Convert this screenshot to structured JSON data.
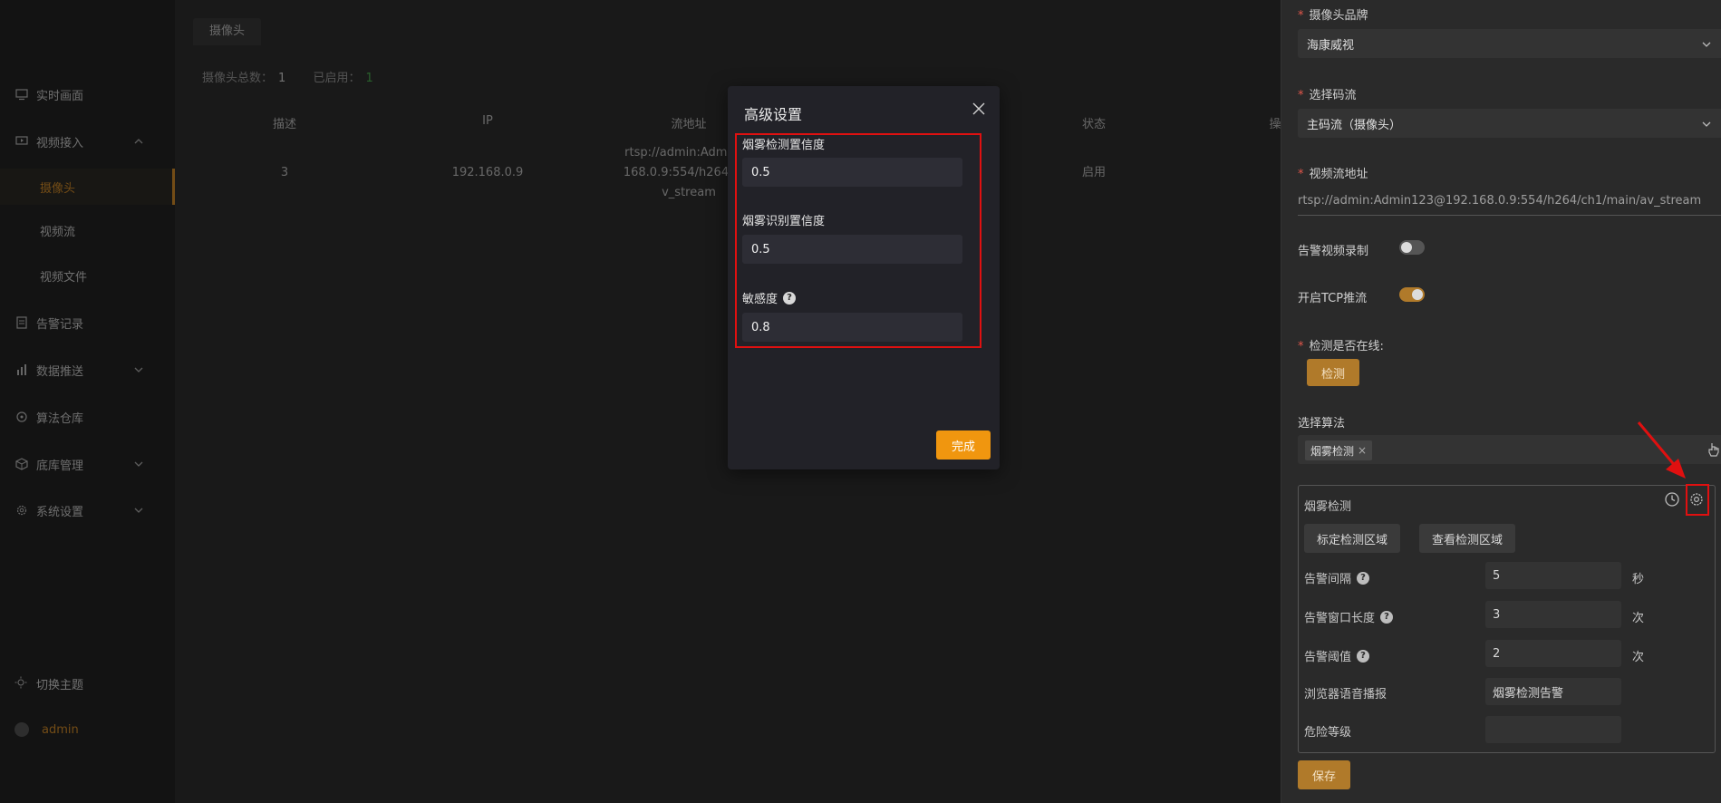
{
  "sidebar": {
    "items": [
      {
        "label": "实时画面"
      },
      {
        "label": "视频接入"
      },
      {
        "label": "告警记录"
      },
      {
        "label": "数据推送"
      },
      {
        "label": "算法仓库"
      },
      {
        "label": "底库管理"
      },
      {
        "label": "系统设置"
      }
    ],
    "sub_items": [
      {
        "label": "摄像头"
      },
      {
        "label": "视频流"
      },
      {
        "label": "视频文件"
      }
    ],
    "theme_label": "切换主题",
    "user_label": "admin"
  },
  "main": {
    "tab_label": "摄像头",
    "stats": {
      "total_label": "摄像头总数：",
      "total_value": "1",
      "enabled_label": "已启用：",
      "enabled_value": "1"
    },
    "table": {
      "headers": [
        "描述",
        "IP",
        "流地址",
        "状态",
        "操"
      ],
      "row": {
        "desc": "3",
        "ip": "192.168.0.9",
        "stream_line1": "rtsp://admin:Admin12",
        "stream_line2": "168.0.9:554/h264/ch1",
        "stream_line3": "v_stream",
        "status": "启用"
      }
    }
  },
  "drawer": {
    "brand_label": "摄像头品牌",
    "brand_value": "海康威视",
    "stream_label": "选择码流",
    "stream_value": "主码流（摄像头）",
    "url_label": "视频流地址",
    "url_value": "rtsp://admin:Admin123@192.168.0.9:554/h264/ch1/main/av_stream",
    "record_label": "告警视频录制",
    "tcp_label": "开启TCP推流",
    "online_label": "检测是否在线:",
    "check_button": "检测",
    "algo_label": "选择算法",
    "algo_chip": "烟雾检测",
    "chip_close": "×",
    "card": {
      "title": "烟雾检测",
      "calibrate_button": "标定检测区域",
      "view_button": "查看检测区域",
      "rows": [
        {
          "label": "告警间隔",
          "value": "5",
          "unit": "秒"
        },
        {
          "label": "告警窗口长度",
          "value": "3",
          "unit": "次"
        },
        {
          "label": "告警阈值",
          "value": "2",
          "unit": "次"
        }
      ],
      "voice_label": "浏览器语音播报",
      "voice_value": "烟雾检测告警",
      "danger_label": "危险等级",
      "danger_value": ""
    },
    "save_button": "保存"
  },
  "modal": {
    "title": "高级设置",
    "fields": [
      {
        "label": "烟雾检测置信度",
        "value": "0.5"
      },
      {
        "label": "烟雾识别置信度",
        "value": "0.5"
      },
      {
        "label": "敏感度",
        "value": "0.8"
      }
    ],
    "done_button": "完成"
  },
  "colors": {
    "accent": "#d18b28",
    "primary_button": "#f0960f",
    "highlight_red": "#e01010"
  }
}
